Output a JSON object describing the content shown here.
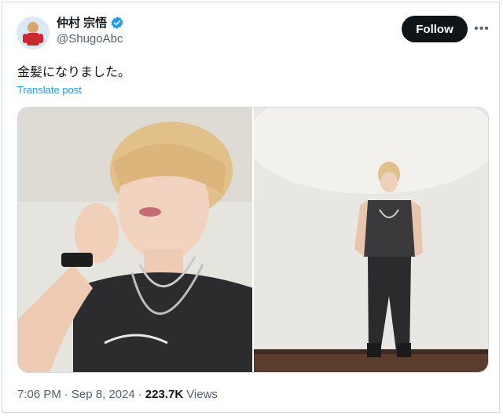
{
  "author": {
    "display_name": "仲村 宗悟",
    "handle": "@ShugoAbc",
    "verified": true,
    "avatar_icon": "avatar-person"
  },
  "actions": {
    "follow_label": "Follow",
    "more_icon": "more-horizontal-icon",
    "more_glyph": "•••"
  },
  "post": {
    "text": "金髪になりました。",
    "translate_label": "Translate post",
    "media": [
      {
        "alt": "photo-closeup-selfie"
      },
      {
        "alt": "photo-full-body"
      }
    ]
  },
  "meta": {
    "time": "7:06 PM",
    "sep1": "·",
    "date": "Sep 8, 2024",
    "sep2": "·",
    "views_count": "223.7K",
    "views_label": "Views"
  },
  "colors": {
    "accent": "#1d9bf0",
    "text": "#0f1419",
    "secondary": "#536471",
    "button": "#0f1419"
  }
}
